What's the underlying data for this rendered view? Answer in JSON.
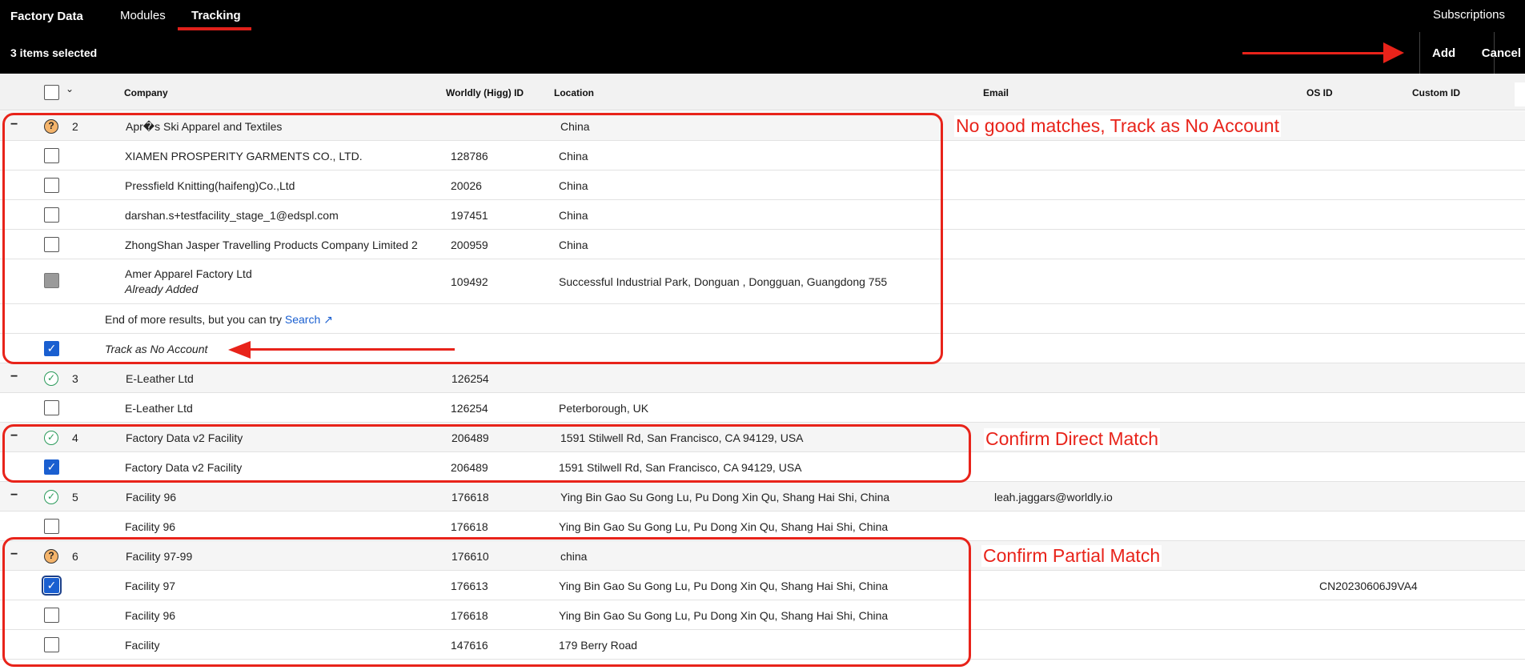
{
  "nav": {
    "brand": "Factory Data",
    "tabs": [
      "Modules",
      "Tracking"
    ],
    "subscriptions": "Subscriptions"
  },
  "selection": {
    "count_text": "3 items selected",
    "add_label": "Add",
    "cancel_label": "Cancel"
  },
  "table": {
    "headers": [
      "Company",
      "Worldly (Higg) ID",
      "Location",
      "Email",
      "OS ID",
      "Custom ID"
    ],
    "rows": [
      {
        "type": "group",
        "status": "question",
        "num": "2",
        "company": "Apr�s Ski Apparel and Textiles",
        "id": "",
        "location": "China",
        "email": "",
        "osid": ""
      },
      {
        "type": "child",
        "checked": false,
        "company": "XIAMEN PROSPERITY GARMENTS CO., LTD.",
        "id": "128786",
        "location": "China",
        "email": "",
        "osid": ""
      },
      {
        "type": "child",
        "checked": false,
        "company": "Pressfield Knitting(haifeng)Co.,Ltd",
        "id": "20026",
        "location": "China",
        "email": "",
        "osid": ""
      },
      {
        "type": "child",
        "checked": false,
        "company": "darshan.s+testfacility_stage_1@edspl.com",
        "id": "197451",
        "location": "China",
        "email": "",
        "osid": ""
      },
      {
        "type": "child",
        "checked": false,
        "company": "ZhongShan Jasper Travelling Products Company Limited 2",
        "id": "200959",
        "location": "China",
        "email": "",
        "osid": ""
      },
      {
        "type": "child-added",
        "company": "Amer Apparel Factory Ltd",
        "subtext": "Already Added",
        "id": "109492",
        "location": "Successful Industrial Park, Donguan , Dongguan, Guangdong 755",
        "email": "",
        "osid": ""
      },
      {
        "type": "more",
        "text": "End of more results, but you can try ",
        "link": "Search ↗"
      },
      {
        "type": "noaccount",
        "checked": true,
        "text": "Track as No Account"
      },
      {
        "type": "group",
        "status": "ok",
        "num": "3",
        "company": "E-Leather Ltd",
        "id": "126254",
        "location": "",
        "email": "",
        "osid": ""
      },
      {
        "type": "child",
        "checked": false,
        "company": "E-Leather Ltd",
        "id": "126254",
        "location": "Peterborough, UK",
        "email": "",
        "osid": ""
      },
      {
        "type": "group",
        "status": "ok",
        "num": "4",
        "company": "Factory Data v2 Facility",
        "id": "206489",
        "location": "1591 Stilwell Rd, San Francisco, CA 94129, USA",
        "email": "",
        "osid": ""
      },
      {
        "type": "child",
        "checked": true,
        "company": "Factory Data v2 Facility",
        "id": "206489",
        "location": "1591 Stilwell Rd, San Francisco, CA 94129, USA",
        "email": "",
        "osid": ""
      },
      {
        "type": "group",
        "status": "ok",
        "num": "5",
        "company": "Facility 96",
        "id": "176618",
        "location": "Ying Bin Gao Su Gong Lu, Pu Dong Xin Qu, Shang Hai Shi, China",
        "email": "leah.jaggars@worldly.io",
        "osid": ""
      },
      {
        "type": "child",
        "checked": false,
        "company": "Facility 96",
        "id": "176618",
        "location": "Ying Bin Gao Su Gong Lu, Pu Dong Xin Qu, Shang Hai Shi, China",
        "email": "",
        "osid": ""
      },
      {
        "type": "group",
        "status": "question",
        "num": "6",
        "company": "Facility 97-99",
        "id": "176610",
        "location": "china",
        "email": "",
        "osid": ""
      },
      {
        "type": "child",
        "checked": true,
        "focus": true,
        "company": "Facility 97",
        "id": "176613",
        "location": "Ying Bin Gao Su Gong Lu, Pu Dong Xin Qu, Shang Hai Shi, China",
        "email": "",
        "osid": "CN20230606J9VA4"
      },
      {
        "type": "child",
        "checked": false,
        "company": "Facility 96",
        "id": "176618",
        "location": "Ying Bin Gao Su Gong Lu, Pu Dong Xin Qu, Shang Hai Shi, China",
        "email": "",
        "osid": ""
      },
      {
        "type": "child",
        "checked": false,
        "company": "Facility",
        "id": "147616",
        "location": "179 Berry Road",
        "email": "",
        "osid": ""
      }
    ]
  },
  "annotations": {
    "no_match": "No good matches, Track as No Account",
    "direct": "Confirm Direct Match",
    "partial": "Confirm Partial Match"
  },
  "colors": {
    "annotation_red": "#e8231a",
    "checkbox_blue": "#1a5fd0",
    "status_green": "#2a9a5a",
    "status_orange": "#f4b46b"
  }
}
